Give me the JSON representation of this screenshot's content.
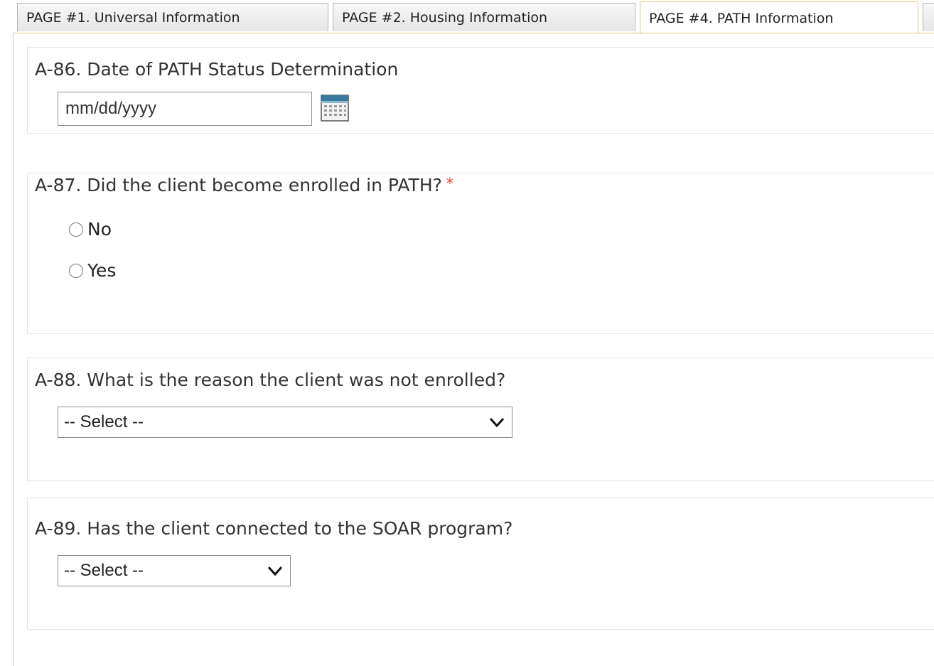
{
  "tabs": [
    {
      "label": "PAGE #1. Universal Information",
      "active": false
    },
    {
      "label": "PAGE #2. Housing Information",
      "active": false
    },
    {
      "label": "PAGE #4. PATH Information",
      "active": true
    }
  ],
  "questions": {
    "a86": {
      "label": "A-86. Date of PATH Status Determination",
      "placeholder": "mm/dd/yyyy",
      "icon": "calendar-icon"
    },
    "a87": {
      "label": "A-87. Did the client become enrolled in PATH?",
      "required_mark": "*",
      "options": [
        "No",
        "Yes"
      ]
    },
    "a88": {
      "label": "A-88. What is the reason the client was not enrolled?",
      "selected": "-- Select --",
      "icon": "chevron-down-icon"
    },
    "a89": {
      "label": "A-89. Has the client connected to the SOAR program?",
      "selected": "-- Select --",
      "icon": "chevron-down-icon"
    }
  },
  "colors": {
    "accent_border": "#e2c77a",
    "required": "#e0413b",
    "text": "#333333"
  }
}
